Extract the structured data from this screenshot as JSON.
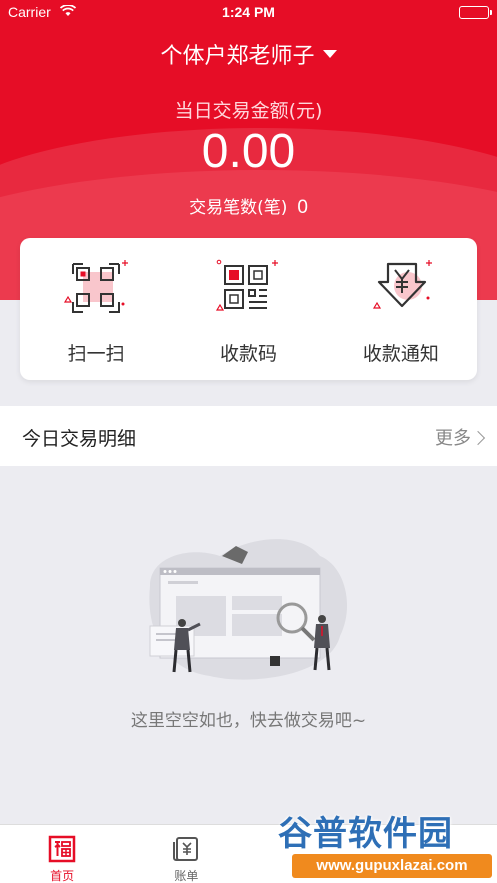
{
  "status_bar": {
    "carrier": "Carrier",
    "time": "1:24 PM"
  },
  "header": {
    "title": "个体户郑老师子",
    "amount_label": "当日交易金额(元)",
    "amount_value": "0.00",
    "count_label": "交易笔数(笔)",
    "count_value": "0"
  },
  "quick_actions": [
    {
      "label": "扫一扫",
      "icon": "scan-icon"
    },
    {
      "label": "收款码",
      "icon": "qrcode-icon"
    },
    {
      "label": "收款通知",
      "icon": "payment-notice-icon"
    }
  ],
  "section": {
    "title": "今日交易明细",
    "more": "更多"
  },
  "empty_state": {
    "message": "这里空空如也，快去做交易吧~"
  },
  "tabbar": {
    "tabs": [
      {
        "label": "首页",
        "icon": "home-fu-icon",
        "active": true
      },
      {
        "label": "账单",
        "icon": "bill-icon",
        "active": false
      },
      {
        "label": "",
        "icon": "hidden-icon",
        "active": false
      },
      {
        "label": "",
        "icon": "hidden-icon",
        "active": false
      }
    ]
  },
  "watermark": {
    "brand": "谷普软件园",
    "url": "www.gupuxlazai.com"
  },
  "colors": {
    "brand_red": "#e60d26",
    "text_dark": "#222222",
    "background": "#ececf1"
  }
}
